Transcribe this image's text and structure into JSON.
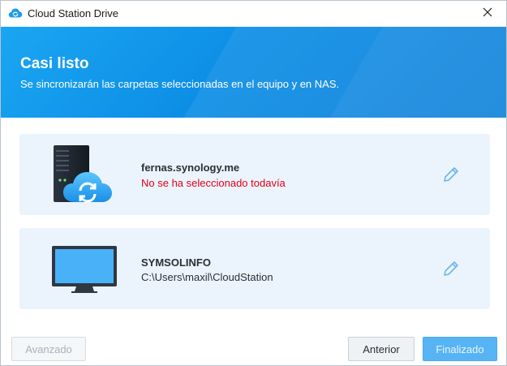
{
  "window": {
    "title": "Cloud Station Drive",
    "app_icon": "cloud-icon",
    "close_icon": "close-icon"
  },
  "banner": {
    "title": "Casi listo",
    "subtitle": "Se sincronizarán las carpetas seleccionadas en el equipo y en NAS.",
    "colors": {
      "start": "#1aa6f2",
      "end": "#0a7fd9"
    }
  },
  "cards": {
    "nas": {
      "icon": "nas-sync-icon",
      "name": "fernas.synology.me",
      "detail": "No se ha seleccionado todavía",
      "detail_color": "#e2001a",
      "edit_icon": "pencil-icon"
    },
    "pc": {
      "icon": "monitor-icon",
      "name": "SYMSOLINFO",
      "detail": "C:\\Users\\maxil\\CloudStation",
      "edit_icon": "pencil-icon"
    }
  },
  "footer": {
    "advanced_label": "Avanzado",
    "back_label": "Anterior",
    "finish_label": "Finalizado"
  },
  "colors": {
    "card_bg": "#ebf4fc",
    "accent": "#57b4f4"
  }
}
